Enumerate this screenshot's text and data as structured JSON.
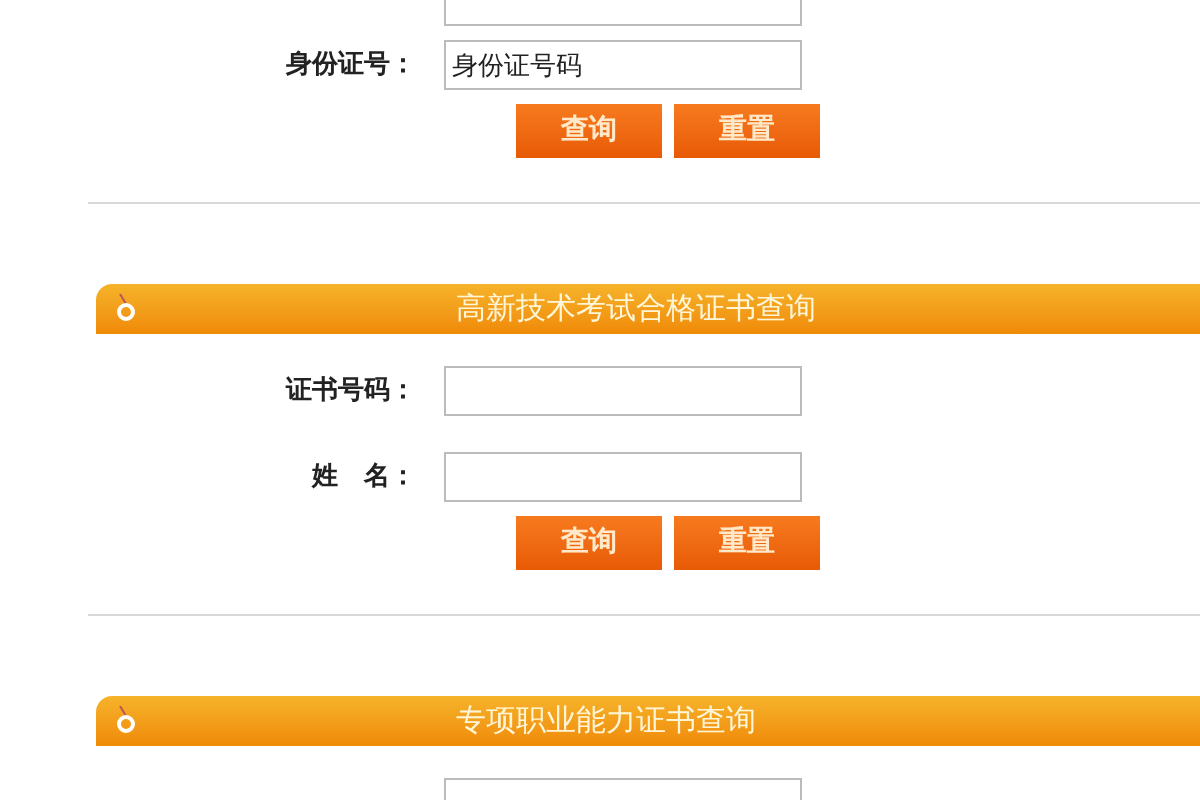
{
  "sections": [
    {
      "fields": [
        {
          "kind": "text_field"
        },
        {
          "kind": "text_field",
          "label": "身份证号：",
          "value": "身份证号码"
        }
      ],
      "buttons": [
        "查询",
        "重置"
      ]
    },
    {
      "title": "高新技术考试合格证书查询",
      "fields": [
        {
          "kind": "text_field",
          "label": "证书号码："
        },
        {
          "kind": "text_field",
          "label": "姓　名："
        }
      ],
      "buttons": [
        "查询",
        "重置"
      ]
    },
    {
      "title": "专项职业能力证书查询",
      "fields": [
        {
          "kind": "text_field"
        }
      ]
    }
  ]
}
